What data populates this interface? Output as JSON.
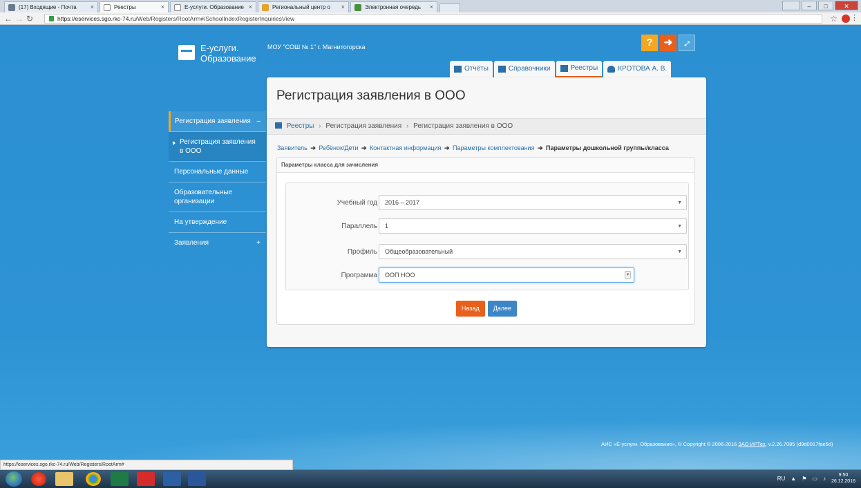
{
  "browser": {
    "tabs": [
      {
        "label": "(17) Входящие - Почта",
        "x": "×"
      },
      {
        "label": "Реестры",
        "x": "×"
      },
      {
        "label": "E-услуги. Образование",
        "x": "×"
      },
      {
        "label": "Региональный центр о",
        "x": "×"
      },
      {
        "label": "Электронная очередь",
        "x": "×"
      }
    ],
    "url_host": "https://eservices.sgo.rkc-74.ru",
    "url_path": "/Web/Registers/RootArm#/SchoolIndexRegisterInquiriesView",
    "status_url": "https://eservices.sgo.rkc-74.ru/Web/Registers/RootArm#"
  },
  "header": {
    "logo_line1": "Е-услуги.",
    "logo_line2": "Образование",
    "org": "МОУ \"СОШ № 1\" г. Магнитогорска",
    "help_icon": "?",
    "nav": [
      {
        "label": "Отчёты",
        "icon": "report-icon"
      },
      {
        "label": "Справочники",
        "icon": "book-icon"
      },
      {
        "label": "Реестры",
        "icon": "list-icon",
        "active": true
      },
      {
        "label": "КРОТОВА А. В.",
        "icon": "user-icon"
      }
    ]
  },
  "sidebar": {
    "items": [
      {
        "label": "Регистрация заявления",
        "sign": "–"
      },
      {
        "label": "Регистрация заявления в ООО"
      },
      {
        "label": "Персональные данные"
      },
      {
        "label": "Образовательные организации"
      },
      {
        "label": "На утверждение"
      },
      {
        "label": "Заявления",
        "sign": "+"
      }
    ]
  },
  "main": {
    "title": "Регистрация заявления в ООО",
    "breadcrumb": [
      "Реестры",
      "Регистрация заявления",
      "Регистрация заявления в ООО"
    ],
    "breadcrumb_sep": "›",
    "steps": [
      "Заявитель",
      "Ребёнок/Дети",
      "Контактная информация",
      "Параметры комплектования"
    ],
    "current_step": "Параметры дошкольной группы/класса",
    "step_arrow": "➔",
    "section_title": "Параметры класса для зачисления",
    "fields": [
      {
        "label": "Учебный год",
        "value": "2016 – 2017"
      },
      {
        "label": "Параллель",
        "value": "1"
      },
      {
        "label": "Профиль",
        "value": "Общеобразовательный"
      },
      {
        "label": "Программа",
        "value": "ООП НОО"
      }
    ],
    "back_label": "Назад",
    "next_label": "Далее"
  },
  "footer": {
    "copyright_pre": "АИС «Е-услуги. Образование», © Copyright © 2006-2016 ",
    "copyright_link": "ЗАО ИРТех",
    "copyright_post": ", v.2.26.7085 (d9d0017fae5d)"
  },
  "taskbar": {
    "lang": "RU",
    "time": "9:50",
    "date": "26.12.2016"
  }
}
